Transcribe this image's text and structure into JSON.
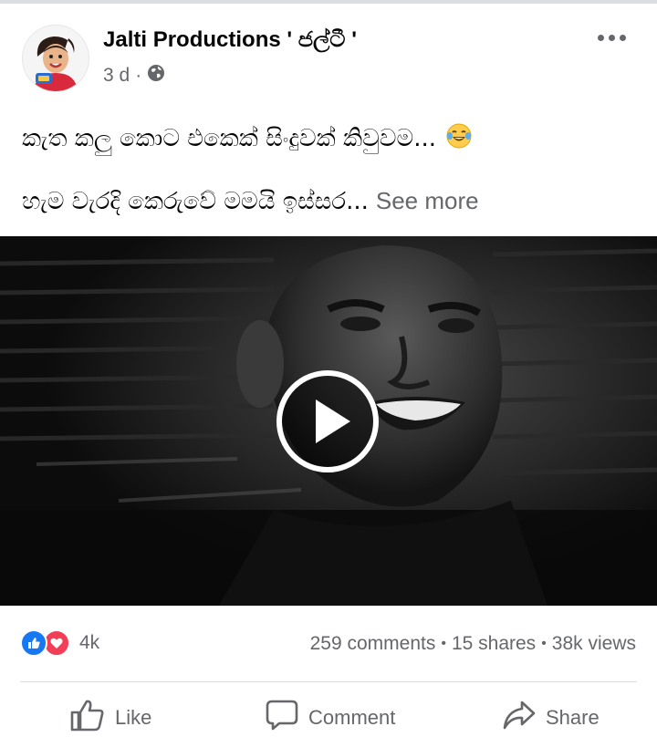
{
  "post": {
    "author": "Jalti Productions ' ජල්ටී '",
    "time": "3 d",
    "audience_icon": "globe-icon",
    "caption_line1": "කැත කලු කොට එකෙක් සිංදුවක් කිවුවම...",
    "caption_emoji": "laughing-tears-emoji",
    "caption_line2": "හැම වැරදි කෙරුවේ මමයි ඉස්සර...",
    "see_more": "See more"
  },
  "video": {
    "play_icon": "play-icon"
  },
  "reactions": {
    "icons": [
      "like-icon",
      "love-icon"
    ],
    "count": "4k"
  },
  "stats": {
    "comments": "259 comments",
    "shares": "15 shares",
    "views": "38k views",
    "separator": "•"
  },
  "actions": {
    "like": "Like",
    "comment": "Comment",
    "share": "Share"
  },
  "colors": {
    "like_blue": "#1877f2",
    "love_red": "#f33e58",
    "secondary_text": "#65676b"
  }
}
